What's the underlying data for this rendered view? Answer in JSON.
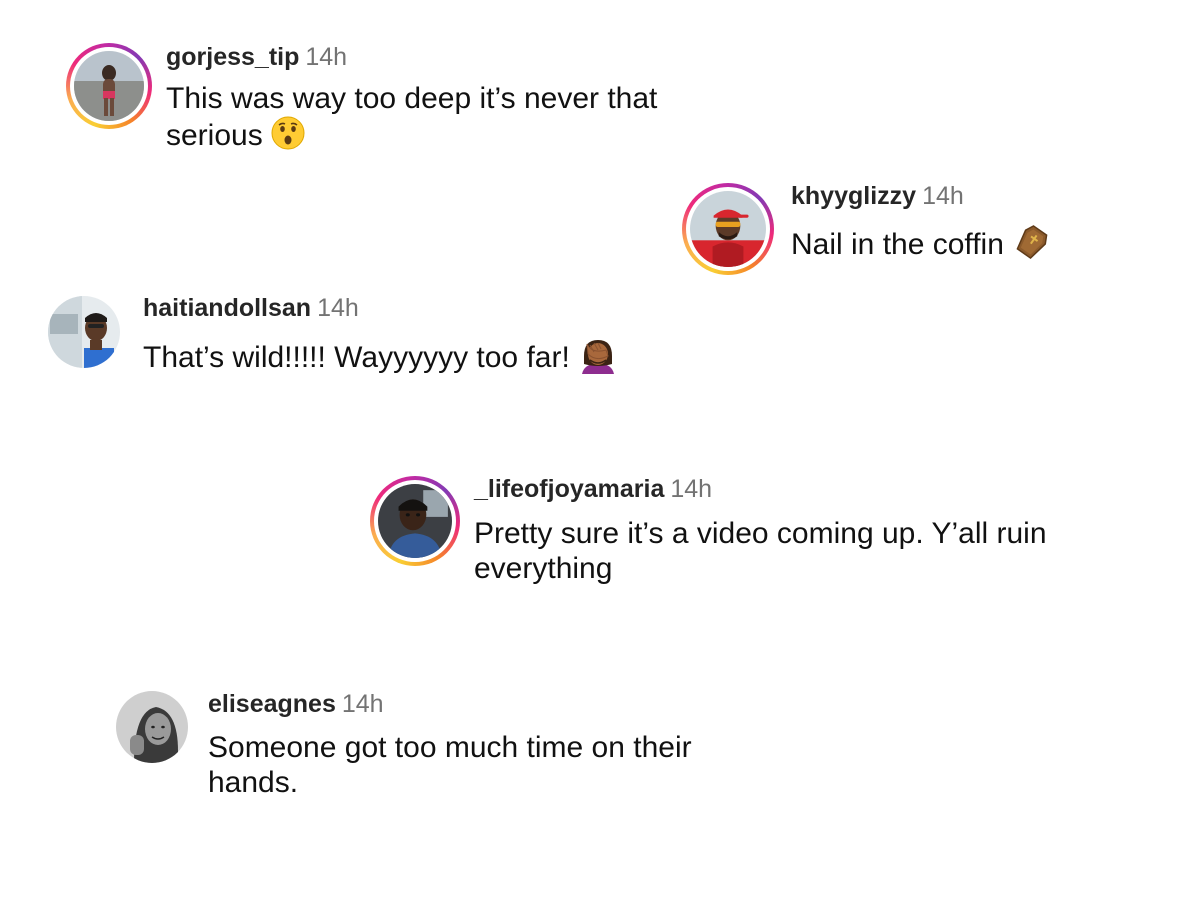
{
  "comments": [
    {
      "username": "gorjess_tip",
      "time": "14h",
      "text": "This was way too deep it’s never that serious",
      "emoji": "hushed-face",
      "has_story_ring": true
    },
    {
      "username": "khyyglizzy",
      "time": "14h",
      "text": "Nail in the coffin",
      "emoji": "coffin",
      "has_story_ring": true
    },
    {
      "username": "haitiandollsan",
      "time": "14h",
      "text": "That’s wild!!!!! Wayyyyyy too far!",
      "emoji": "woman-facepalming",
      "has_story_ring": false
    },
    {
      "username": "_lifeofjoyamaria",
      "time": "14h",
      "text": "Pretty sure it’s a video coming up. Y’all ruin everything",
      "emoji": "",
      "has_story_ring": true
    },
    {
      "username": "eliseagnes",
      "time": "14h",
      "text": "Someone got too much time on their hands.",
      "emoji": "",
      "has_story_ring": false
    }
  ],
  "colors": {
    "username": "#262626",
    "timestamp": "#737373",
    "text": "#111111",
    "story_ring_gradient": [
      "#f9ce34",
      "#ee2a7b",
      "#6228d7"
    ]
  }
}
